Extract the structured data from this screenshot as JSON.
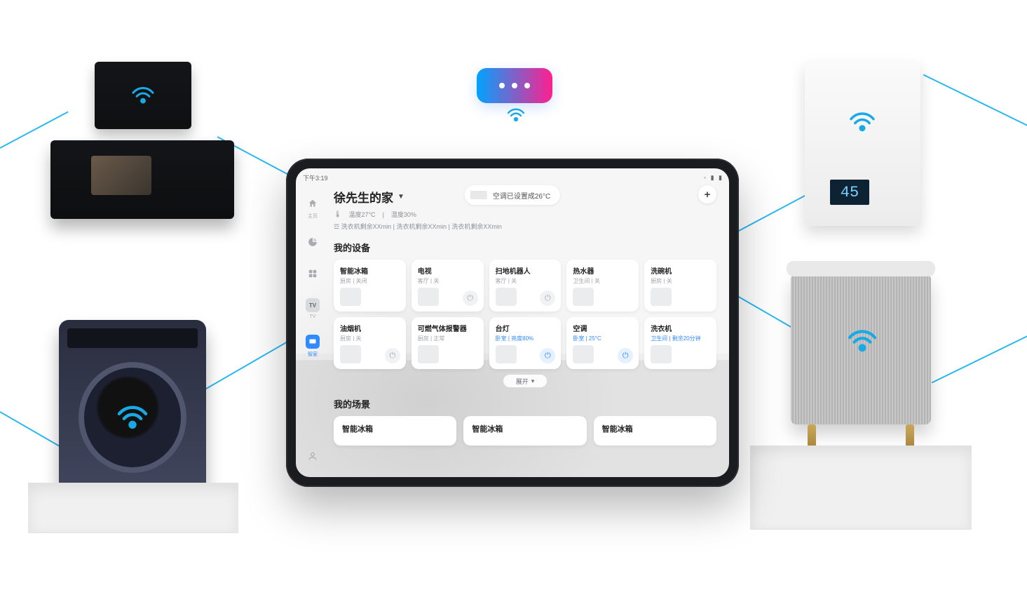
{
  "statusbar": {
    "time": "下午3:19"
  },
  "top_pill": "空调已设置成26°C",
  "home": {
    "title": "徐先生的家",
    "temp_label": "温度27°C",
    "humidity_label": "湿度30%",
    "tasks": [
      "洗衣机剩余XXmin",
      "洗衣机剩余XXmin",
      "洗衣机剩余XXmin"
    ]
  },
  "rail": {
    "items": [
      {
        "id": "home",
        "label": "主页"
      },
      {
        "id": "stats",
        "label": ""
      },
      {
        "id": "grid",
        "label": ""
      },
      {
        "id": "tv",
        "label": "TV"
      },
      {
        "id": "smart",
        "label": "智家"
      }
    ],
    "active": "smart"
  },
  "sections": {
    "devices_title": "我的设备",
    "scenes_title": "我的场景",
    "expand_label": "展开"
  },
  "devices": [
    {
      "name": "智能冰箱",
      "sub": "厨房 | 关闭",
      "on": false,
      "power": false
    },
    {
      "name": "电视",
      "sub": "客厅 | 关",
      "on": false,
      "power": true
    },
    {
      "name": "扫地机器人",
      "sub": "客厅 | 关",
      "on": false,
      "power": true
    },
    {
      "name": "热水器",
      "sub": "卫生间 | 关",
      "on": false,
      "power": false
    },
    {
      "name": "洗碗机",
      "sub": "厨房 | 关",
      "on": false,
      "power": false
    },
    {
      "name": "油烟机",
      "sub": "厨房 | 关",
      "on": false,
      "power": true
    },
    {
      "name": "可燃气体报警器",
      "sub": "厨房 | 正常",
      "on": false,
      "power": false
    },
    {
      "name": "台灯",
      "sub": "卧室 | 亮度80%",
      "on": true,
      "power": true
    },
    {
      "name": "空调",
      "sub": "卧室 | 25°C",
      "on": true,
      "power": true
    },
    {
      "name": "洗衣机",
      "sub": "卫生间 | 剩余20分钟",
      "on": true,
      "power": false
    }
  ],
  "scenes": [
    {
      "name": "智能冰箱"
    },
    {
      "name": "智能冰箱"
    },
    {
      "name": "智能冰箱"
    }
  ],
  "heater": {
    "readout": "45"
  }
}
